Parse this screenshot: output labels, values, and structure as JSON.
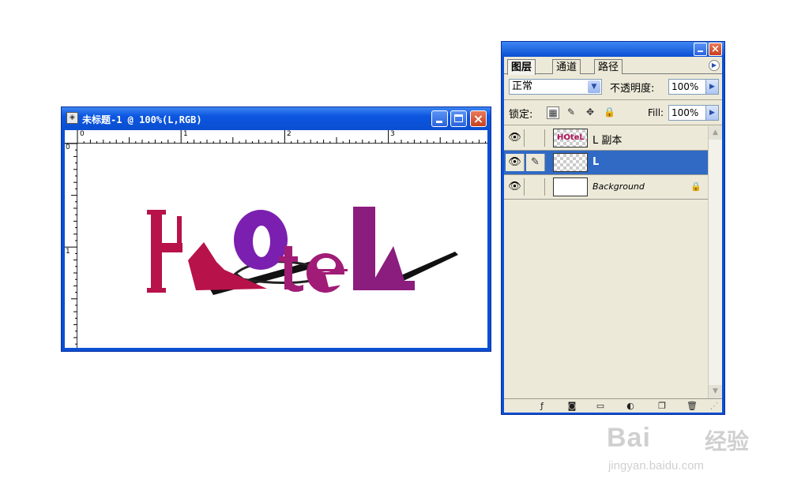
{
  "document_window": {
    "title": "未标题-1 @ 100%(L,RGB)",
    "ruler_top_labels": [
      "0",
      "1",
      "2",
      "3"
    ],
    "ruler_left_labels": [
      "0",
      "1"
    ]
  },
  "artwork": {
    "letters": [
      "H",
      "O",
      "t",
      "e",
      "L"
    ],
    "colors": {
      "h": "#b8124a",
      "o": "#7b1fb0",
      "te": "#a01c76",
      "l": "#8b1d7e"
    }
  },
  "layers_panel": {
    "tabs": [
      "图层",
      "通道",
      "路径"
    ],
    "blend_mode": "正常",
    "opacity_label": "不透明度:",
    "opacity_value": "100%",
    "lock_label": "锁定:",
    "fill_label": "Fill:",
    "fill_value": "100%",
    "layers": [
      {
        "name": "L 副本",
        "selected": false,
        "thumb_text": "HOteL"
      },
      {
        "name": "L",
        "selected": true,
        "thumb_text": ""
      },
      {
        "name": "Background",
        "selected": false,
        "thumb_text": ""
      }
    ],
    "footer_icons": [
      "layer-style-icon",
      "mask-icon",
      "folder-icon",
      "adjustment-icon",
      "new-layer-icon",
      "trash-icon"
    ]
  },
  "watermark": {
    "logo": "Bai",
    "logo_suffix": "经验",
    "url": "jingyan.baidu.com"
  },
  "colors": {
    "titlebar": "#0b4fd4",
    "panel_bg": "#ece9d8",
    "selection": "#316ac5"
  }
}
